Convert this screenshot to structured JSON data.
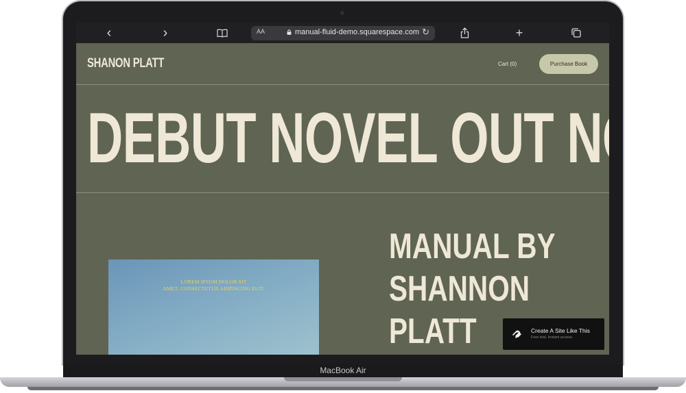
{
  "browser": {
    "url": "manual-fluid-demo.squarespace.com",
    "aa_label": "AA",
    "reload_glyph": "↻",
    "back_glyph": "‹",
    "forward_glyph": "›",
    "new_tab_glyph": "+",
    "icons": {
      "back": "chevron-left-icon",
      "forward": "chevron-right-icon",
      "bookmarks": "book-icon",
      "lock": "lock-icon",
      "reload": "reload-icon",
      "share": "share-icon",
      "new_tab": "plus-icon",
      "tabs": "tabs-icon"
    }
  },
  "site": {
    "brand": "SHANON PLATT",
    "cart_label": "Cart (0)",
    "purchase_label": "Purchase Book",
    "hero_title": "DEBUT NOVEL OUT NOW",
    "book_caption_line1": "LOREM IPSUM DOLOR SIT",
    "book_caption_line2": "AMET, CONSECTETUR ADIPISCING ELIT.",
    "book_heading_line1": "MANUAL BY",
    "book_heading_line2": "SHANNON",
    "book_heading_line3": "PLATT"
  },
  "squarespace_badge": {
    "title": "Create A Site Like This",
    "subtitle": "Free trial. Instant access."
  },
  "device": {
    "label": "MacBook Air"
  },
  "colors": {
    "page_bg": "#5f6453",
    "cream_text": "#efe8d6",
    "button_bg": "#c6c8a9",
    "caption_yellow": "#e7d55d",
    "toolbar_bg": "#202022"
  }
}
